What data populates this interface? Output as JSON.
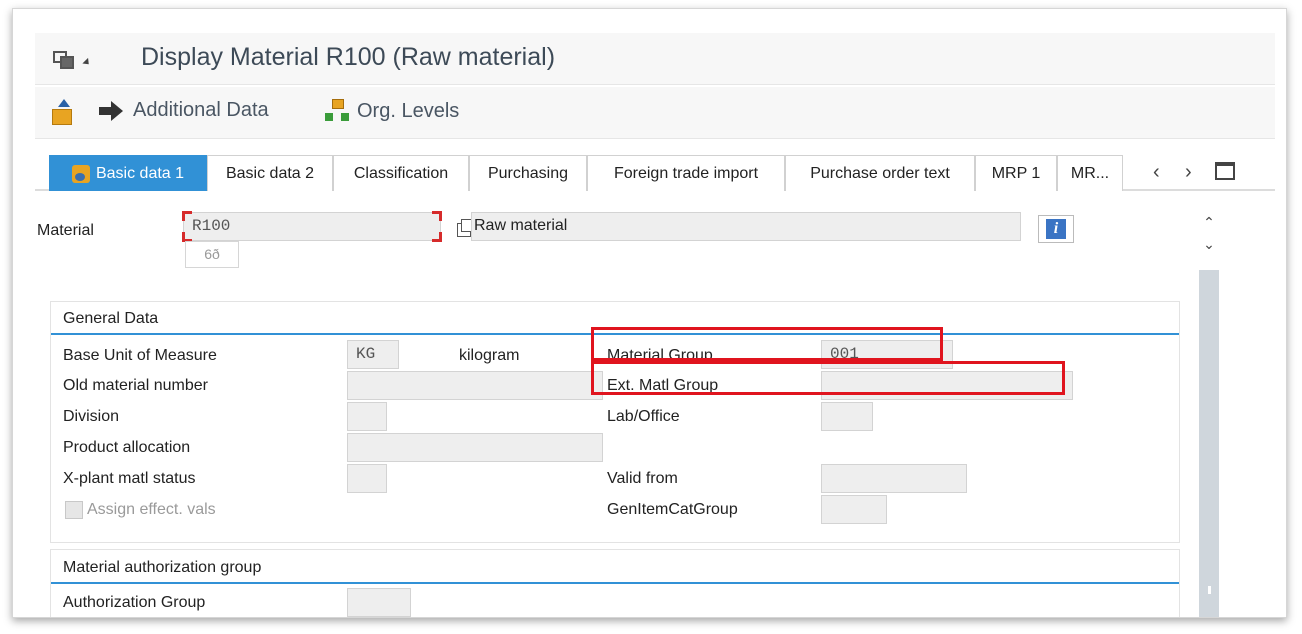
{
  "window": {
    "title": "Display Material R100 (Raw material)"
  },
  "toolbar": {
    "additional_data": "Additional Data",
    "org_levels": "Org. Levels"
  },
  "tabs": [
    {
      "label": "Basic data 1",
      "active": true
    },
    {
      "label": "Basic data 2"
    },
    {
      "label": "Classification"
    },
    {
      "label": "Purchasing"
    },
    {
      "label": "Foreign trade import"
    },
    {
      "label": "Purchase order text"
    },
    {
      "label": "MRP 1"
    },
    {
      "label": "MR..."
    }
  ],
  "tab_nav": {
    "prev": "‹",
    "next": "›"
  },
  "header": {
    "material_label": "Material",
    "material_value": "R100",
    "material_desc": "Raw material",
    "glasses": "6ð"
  },
  "general_data": {
    "title": "General Data",
    "base_uom_label": "Base Unit of Measure",
    "base_uom_value": "KG",
    "base_uom_text": "kilogram",
    "old_material_label": "Old material number",
    "old_material_value": "",
    "division_label": "Division",
    "division_value": "",
    "product_allocation_label": "Product allocation",
    "product_allocation_value": "",
    "xplant_status_label": "X-plant matl status",
    "xplant_status_value": "",
    "assign_effect_label": "Assign effect. vals",
    "material_group_label": "Material Group",
    "material_group_value": "001",
    "ext_matl_group_label": "Ext. Matl Group",
    "ext_matl_group_value": "",
    "lab_office_label": "Lab/Office",
    "lab_office_value": "",
    "valid_from_label": "Valid from",
    "valid_from_value": "",
    "gen_item_cat_label": "GenItemCatGroup",
    "gen_item_cat_value": ""
  },
  "auth_group": {
    "title": "Material authorization group",
    "authorization_group_label": "Authorization Group"
  },
  "colors": {
    "accent": "#3191d6",
    "highlight": "#e0141e",
    "field_bg": "#eeeeee"
  },
  "icons": [
    "menu-icon",
    "export-icon",
    "arrow-right-icon",
    "org-levels-icon",
    "info-icon",
    "copy-icon",
    "display-glasses-icon",
    "tab-list-icon"
  ]
}
